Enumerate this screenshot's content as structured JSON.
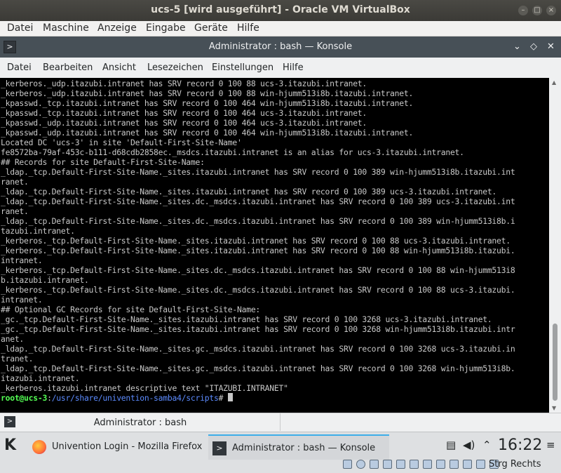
{
  "vbox": {
    "title": "ucs-5 [wird ausgeführt] - Oracle VM VirtualBox",
    "menu": [
      "Datei",
      "Maschine",
      "Anzeige",
      "Eingabe",
      "Geräte",
      "Hilfe"
    ],
    "host_key": "Strg Rechts"
  },
  "konsole": {
    "title": "Administrator : bash — Konsole",
    "menu": [
      "Datei",
      "Bearbeiten",
      "Ansicht",
      "Lesezeichen",
      "Einstellungen",
      "Hilfe"
    ],
    "tab_label": "Administrator : bash",
    "lines": [
      "_kerberos._udp.itazubi.intranet has SRV record 0 100 88 ucs-3.itazubi.intranet.",
      "_kerberos._udp.itazubi.intranet has SRV record 0 100 88 win-hjumm513i8b.itazubi.intranet.",
      "_kpasswd._tcp.itazubi.intranet has SRV record 0 100 464 win-hjumm513i8b.itazubi.intranet.",
      "_kpasswd._tcp.itazubi.intranet has SRV record 0 100 464 ucs-3.itazubi.intranet.",
      "_kpasswd._udp.itazubi.intranet has SRV record 0 100 464 ucs-3.itazubi.intranet.",
      "_kpasswd._udp.itazubi.intranet has SRV record 0 100 464 win-hjumm513i8b.itazubi.intranet.",
      "Located DC 'ucs-3' in site 'Default-First-Site-Name'",
      "fe8572ba-79af-453c-b111-d68cdb2858ec._msdcs.itazubi.intranet is an alias for ucs-3.itazubi.intranet.",
      "## Records for site Default-First-Site-Name:",
      "_ldap._tcp.Default-First-Site-Name._sites.itazubi.intranet has SRV record 0 100 389 win-hjumm513i8b.itazubi.int",
      "ranet.",
      "_ldap._tcp.Default-First-Site-Name._sites.itazubi.intranet has SRV record 0 100 389 ucs-3.itazubi.intranet.",
      "_ldap._tcp.Default-First-Site-Name._sites.dc._msdcs.itazubi.intranet has SRV record 0 100 389 ucs-3.itazubi.int",
      "ranet.",
      "_ldap._tcp.Default-First-Site-Name._sites.dc._msdcs.itazubi.intranet has SRV record 0 100 389 win-hjumm513i8b.i",
      "tazubi.intranet.",
      "_kerberos._tcp.Default-First-Site-Name._sites.itazubi.intranet has SRV record 0 100 88 ucs-3.itazubi.intranet.",
      "_kerberos._tcp.Default-First-Site-Name._sites.itazubi.intranet has SRV record 0 100 88 win-hjumm513i8b.itazubi.",
      "intranet.",
      "_kerberos._tcp.Default-First-Site-Name._sites.dc._msdcs.itazubi.intranet has SRV record 0 100 88 win-hjumm513i8",
      "b.itazubi.intranet.",
      "_kerberos._tcp.Default-First-Site-Name._sites.dc._msdcs.itazubi.intranet has SRV record 0 100 88 ucs-3.itazubi.",
      "intranet.",
      "## Optional GC Records for site Default-First-Site-Name:",
      "_gc._tcp.Default-First-Site-Name._sites.itazubi.intranet has SRV record 0 100 3268 ucs-3.itazubi.intranet.",
      "_gc._tcp.Default-First-Site-Name._sites.itazubi.intranet has SRV record 0 100 3268 win-hjumm513i8b.itazubi.intr",
      "anet.",
      "_ldap._tcp.Default-First-Site-Name._sites.gc._msdcs.itazubi.intranet has SRV record 0 100 3268 ucs-3.itazubi.in",
      "tranet.",
      "_ldap._tcp.Default-First-Site-Name._sites.gc._msdcs.itazubi.intranet has SRV record 0 100 3268 win-hjumm513i8b.",
      "itazubi.intranet.",
      "_kerberos.itazubi.intranet descriptive text \"ITAZUBI.INTRANET\""
    ],
    "prompt_user": "root@ucs-3",
    "prompt_sep": ":",
    "prompt_path": "/usr/share/univention-samba4/scripts",
    "prompt_end": "# "
  },
  "taskbar": {
    "tasks": [
      {
        "label": "Univention Login - Mozilla Firefox",
        "icon": "firefox-icon"
      },
      {
        "label": "Administrator : bash — Konsole",
        "icon": "konsole-icon"
      }
    ],
    "clock": "16:22"
  }
}
